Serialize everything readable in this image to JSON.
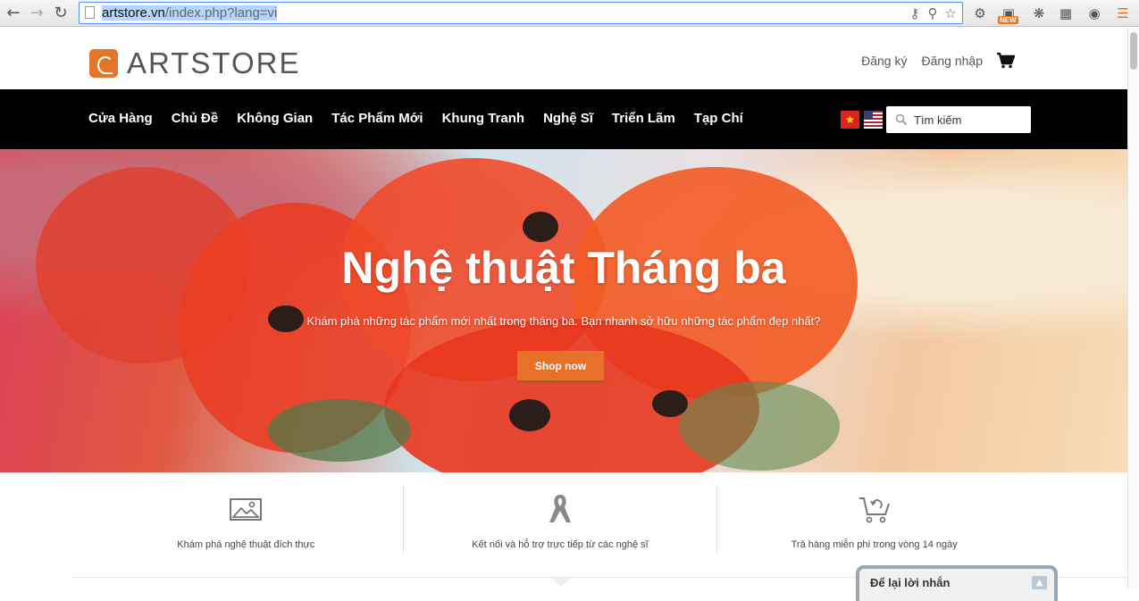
{
  "browser": {
    "url_host": "artstore.vn",
    "url_path": "/index.php?lang=vi",
    "ext_new_badge": "NEW"
  },
  "header": {
    "logo_text": "ARTSTORE",
    "register": "Đăng ký",
    "login": "Đăng nhập"
  },
  "nav": {
    "items": [
      "Cửa Hàng",
      "Chủ Đề",
      "Không Gian",
      "Tác Phẩm Mới",
      "Khung Tranh",
      "Nghệ Sĩ",
      "Triển Lãm",
      "Tạp Chí"
    ],
    "search_placeholder": "Tìm kiếm"
  },
  "hero": {
    "title": "Nghệ thuật Tháng ba",
    "subtitle": "Khám phá những tác phẩm mới nhất trong tháng ba. Bạn nhanh sở hữu những tác phẩm đẹp nhất?",
    "button": "Shop now"
  },
  "features": [
    {
      "label": "Khám phá nghệ thuật đích thực",
      "icon": "picture-icon"
    },
    {
      "label": "Kết nối và hỗ trợ trực tiếp từ các nghệ sĩ",
      "icon": "ribbon-icon"
    },
    {
      "label": "Trả hàng miễn phí trong vòng 14 ngày",
      "icon": "cart-return-icon"
    }
  ],
  "chat": {
    "title": "Để lại lời nhắn"
  },
  "colors": {
    "accent": "#e8712a",
    "nav_bg": "#000000"
  }
}
